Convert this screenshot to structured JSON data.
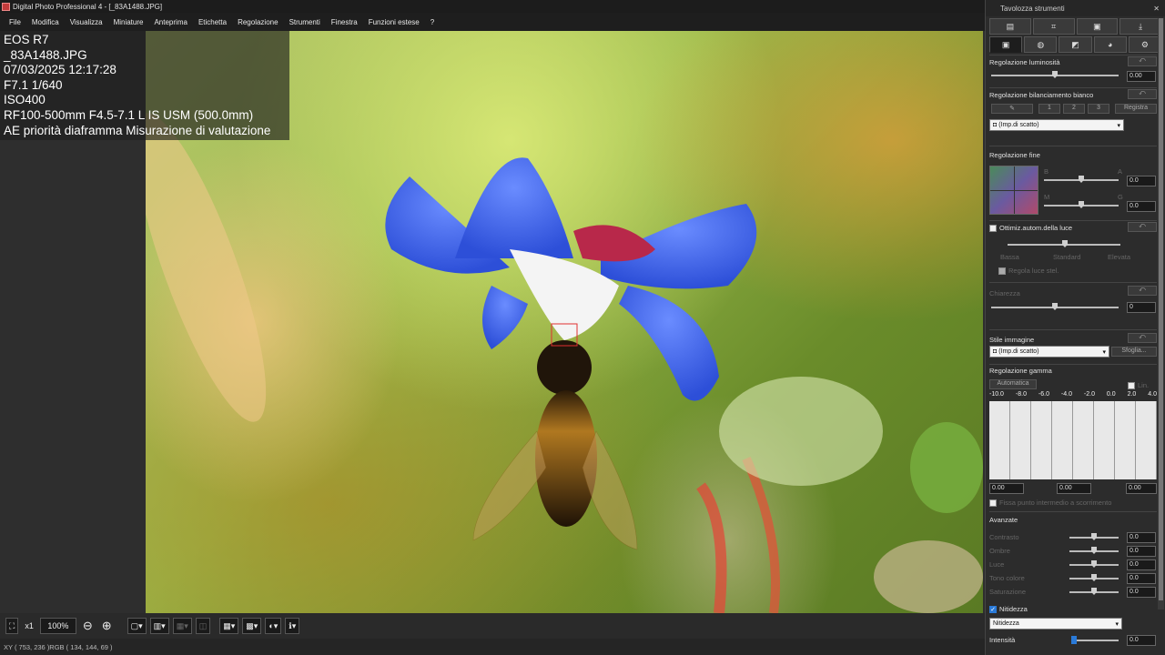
{
  "window": {
    "title": "Digital Photo Professional 4 - [_83A1488.JPG]"
  },
  "menu": [
    "File",
    "Modifica",
    "Visualizza",
    "Miniature",
    "Anteprima",
    "Etichetta",
    "Regolazione",
    "Strumenti",
    "Finestra",
    "Funzioni estese",
    "?"
  ],
  "info": [
    "EOS R7",
    "_83A1488.JPG",
    "07/03/2025 12:17:28",
    "F7.1 1/640",
    "ISO400",
    "RF100-500mm F4.5-7.1 L IS USM (500.0mm)",
    "AE priorità diaframma Misurazione di valutazione"
  ],
  "toolbar": {
    "zoom_x1": "x1",
    "zoom_level": "100%",
    "minus": "⊖",
    "plus": "⊕"
  },
  "status": "XY ( 753,  236 )RGB ( 134, 144,  69 )",
  "panel": {
    "title": "Tavolozza strumenti",
    "brightness": {
      "label": "Regolazione luminosità",
      "value": "0.00"
    },
    "wb": {
      "label": "Regolazione bilanciamento bianco",
      "btn1": "1",
      "btn2": "2",
      "btn3": "3",
      "register": "Registra",
      "select": "(Imp.di scatto)"
    },
    "fine": {
      "label": "Regolazione fine",
      "b": "B",
      "a": "A",
      "m": "M",
      "g": "G",
      "v1": "0.0",
      "v2": "0.0"
    },
    "alo": {
      "label": "Ottimiz.autom.della luce",
      "low": "Bassa",
      "std": "Standard",
      "high": "Elevata",
      "spot": "Regola luce stel."
    },
    "clarity": {
      "label": "Chiarezza",
      "value": "0"
    },
    "style": {
      "label": "Stile immagine",
      "select": "(Imp.di scatto)",
      "browse": "Sfoglia..."
    },
    "gamma": {
      "label": "Regolazione gamma",
      "auto": "Automatica",
      "lin": "Lin.",
      "scale": [
        "-10.0",
        "-8.0",
        "-6.0",
        "-4.0",
        "-2.0",
        "0.0",
        "2.0",
        "4.0"
      ],
      "v1": "0.00",
      "v2": "0.00",
      "v3": "0.00",
      "fixed": "Fissa punto intermedio a scorrimento"
    },
    "adv": {
      "label": "Avanzate",
      "items": [
        "Contrasto",
        "Ombre",
        "Luce",
        "Tono colore",
        "Saturazione"
      ],
      "values": [
        "0.0",
        "0.0",
        "0.0",
        "0.0",
        "0.0"
      ]
    },
    "sharp": {
      "label": "Nitidezza",
      "select": "Nitidezza",
      "intensity": "Intensità",
      "value": "0.0"
    }
  }
}
